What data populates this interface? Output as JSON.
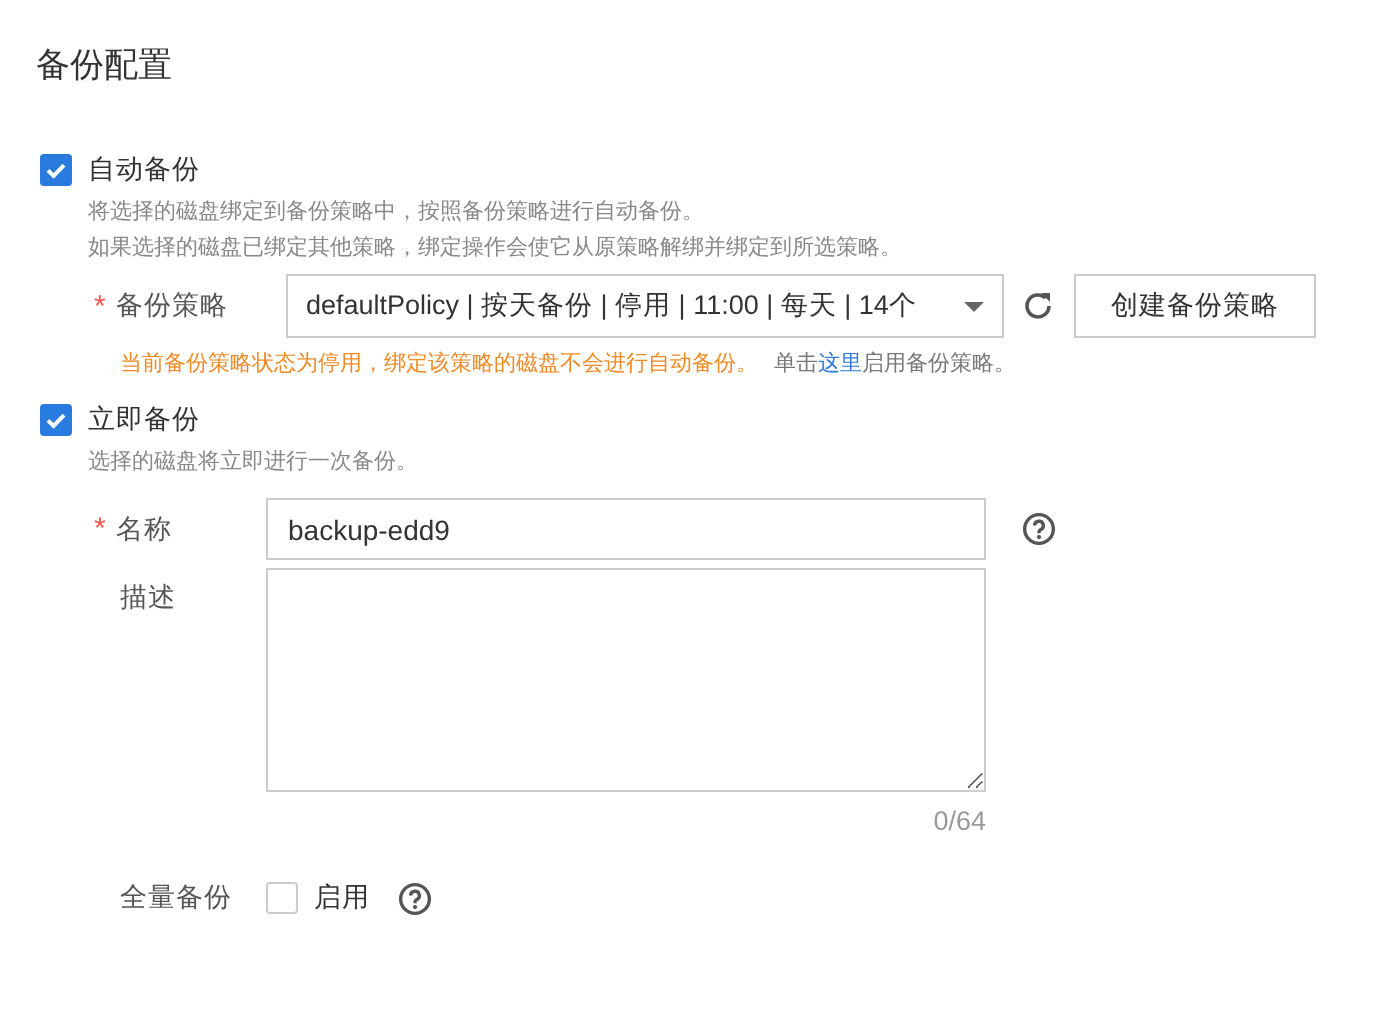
{
  "title": "备份配置",
  "auto_backup": {
    "label": "自动备份",
    "checked": true,
    "descriptions": [
      "将选择的磁盘绑定到备份策略中，按照备份策略进行自动备份。",
      "如果选择的磁盘已绑定其他策略，绑定操作会使它从原策略解绑并绑定到所选策略。"
    ],
    "policy": {
      "required_mark": "*",
      "label": "备份策略",
      "value": "defaultPolicy | 按天备份 | 停用 | 11:00 | 每天 | 14个",
      "create_button": "创建备份策略"
    },
    "warning": "当前备份策略状态为停用，绑定该策略的磁盘不会进行自动备份。",
    "hint_before": "单击",
    "hint_link": "这里",
    "hint_after": "启用备份策略。"
  },
  "instant_backup": {
    "label": "立即备份",
    "checked": true,
    "descriptions": [
      "选择的磁盘将立即进行一次备份。"
    ],
    "name": {
      "required_mark": "*",
      "label": "名称",
      "value": "backup-edd9"
    },
    "description": {
      "label": "描述",
      "counter": "0/64"
    },
    "full_backup": {
      "label": "全量备份",
      "option": "启用",
      "checked": false
    }
  }
}
